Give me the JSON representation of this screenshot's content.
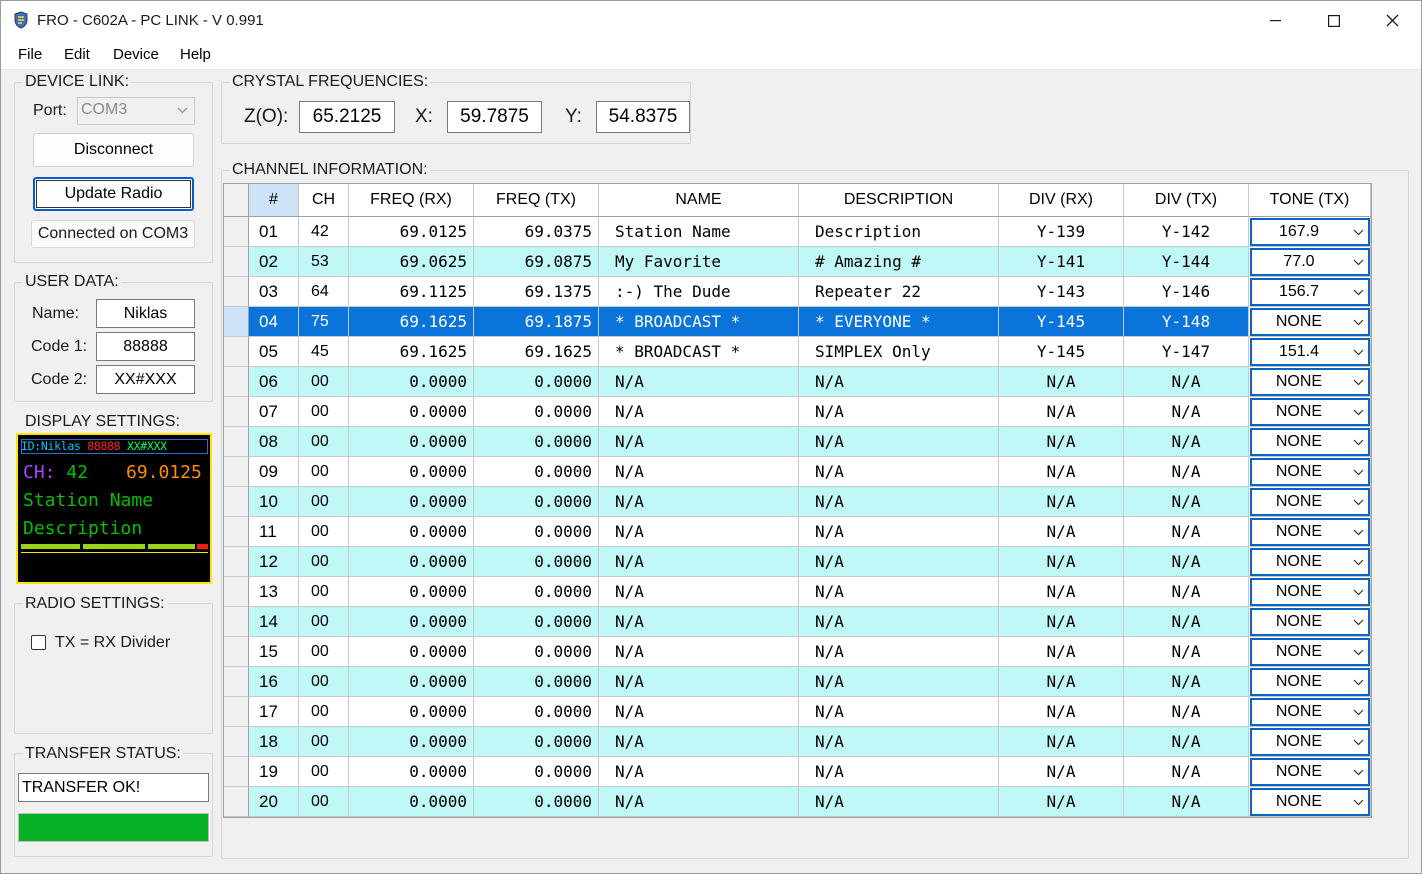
{
  "window": {
    "title": "FRO - C602A - PC LINK - V 0.991"
  },
  "menu": [
    "File",
    "Edit",
    "Device",
    "Help"
  ],
  "device_link": {
    "title": "DEVICE LINK:",
    "port_label": "Port:",
    "port_value": "COM3",
    "disconnect_label": "Disconnect",
    "update_label": "Update Radio",
    "status": "Connected on COM3"
  },
  "user_data": {
    "title": "USER DATA:",
    "name_label": "Name:",
    "name_value": "Niklas",
    "code1_label": "Code 1:",
    "code1_value": "88888",
    "code2_label": "Code 2:",
    "code2_value": "XX#XXX"
  },
  "display_settings": {
    "title": "DISPLAY SETTINGS:",
    "top_id": "ID:Niklas",
    "top_code1": "88888",
    "top_code2": "XX#XXX",
    "ch_label": "CH:",
    "ch_value": "42",
    "freq": "69.0125",
    "line2": "Station Name",
    "line3": "Description",
    "colors": {
      "id": "#00c8ff",
      "code1": "#ff2020",
      "code2": "#00ff66",
      "ch": "#b040ff",
      "freq": "#ff8c00",
      "text": "#00c000"
    }
  },
  "radio_settings": {
    "title": "RADIO SETTINGS:",
    "tx_rx_label": "TX = RX Divider",
    "tx_rx_checked": false
  },
  "transfer_status": {
    "title": "TRANSFER STATUS:",
    "text": "TRANSFER OK!",
    "progress": 1.0
  },
  "crystal": {
    "title": "CRYSTAL FREQUENCIES:",
    "z_label": "Z(O):",
    "z_value": "65.2125",
    "x_label": "X:",
    "x_value": "59.7875",
    "y_label": "Y:",
    "y_value": "54.8375"
  },
  "channels": {
    "title": "CHANNEL INFORMATION:",
    "headers": [
      "#",
      "CH",
      "FREQ (RX)",
      "FREQ (TX)",
      "NAME",
      "DESCRIPTION",
      "DIV (RX)",
      "DIV (TX)",
      "TONE (TX)"
    ],
    "selected_row": 3,
    "rows": [
      [
        "01",
        "42",
        "69.0125",
        "69.0375",
        "Station Name",
        "Description",
        "Y-139",
        "Y-142",
        "167.9"
      ],
      [
        "02",
        "53",
        "69.0625",
        "69.0875",
        "My Favorite",
        "# Amazing #",
        "Y-141",
        "Y-144",
        "77.0"
      ],
      [
        "03",
        "64",
        "69.1125",
        "69.1375",
        ":-) The Dude",
        "Repeater 22",
        "Y-143",
        "Y-146",
        "156.7"
      ],
      [
        "04",
        "75",
        "69.1625",
        "69.1875",
        "* BROADCAST *",
        "* EVERYONE *",
        "Y-145",
        "Y-148",
        "NONE"
      ],
      [
        "05",
        "45",
        "69.1625",
        "69.1625",
        "* BROADCAST *",
        "SIMPLEX Only",
        "Y-145",
        "Y-147",
        "151.4"
      ],
      [
        "06",
        "00",
        "0.0000",
        "0.0000",
        "N/A",
        "N/A",
        "N/A",
        "N/A",
        "NONE"
      ],
      [
        "07",
        "00",
        "0.0000",
        "0.0000",
        "N/A",
        "N/A",
        "N/A",
        "N/A",
        "NONE"
      ],
      [
        "08",
        "00",
        "0.0000",
        "0.0000",
        "N/A",
        "N/A",
        "N/A",
        "N/A",
        "NONE"
      ],
      [
        "09",
        "00",
        "0.0000",
        "0.0000",
        "N/A",
        "N/A",
        "N/A",
        "N/A",
        "NONE"
      ],
      [
        "10",
        "00",
        "0.0000",
        "0.0000",
        "N/A",
        "N/A",
        "N/A",
        "N/A",
        "NONE"
      ],
      [
        "11",
        "00",
        "0.0000",
        "0.0000",
        "N/A",
        "N/A",
        "N/A",
        "N/A",
        "NONE"
      ],
      [
        "12",
        "00",
        "0.0000",
        "0.0000",
        "N/A",
        "N/A",
        "N/A",
        "N/A",
        "NONE"
      ],
      [
        "13",
        "00",
        "0.0000",
        "0.0000",
        "N/A",
        "N/A",
        "N/A",
        "N/A",
        "NONE"
      ],
      [
        "14",
        "00",
        "0.0000",
        "0.0000",
        "N/A",
        "N/A",
        "N/A",
        "N/A",
        "NONE"
      ],
      [
        "15",
        "00",
        "0.0000",
        "0.0000",
        "N/A",
        "N/A",
        "N/A",
        "N/A",
        "NONE"
      ],
      [
        "16",
        "00",
        "0.0000",
        "0.0000",
        "N/A",
        "N/A",
        "N/A",
        "N/A",
        "NONE"
      ],
      [
        "17",
        "00",
        "0.0000",
        "0.0000",
        "N/A",
        "N/A",
        "N/A",
        "N/A",
        "NONE"
      ],
      [
        "18",
        "00",
        "0.0000",
        "0.0000",
        "N/A",
        "N/A",
        "N/A",
        "N/A",
        "NONE"
      ],
      [
        "19",
        "00",
        "0.0000",
        "0.0000",
        "N/A",
        "N/A",
        "N/A",
        "N/A",
        "NONE"
      ],
      [
        "20",
        "00",
        "0.0000",
        "0.0000",
        "N/A",
        "N/A",
        "N/A",
        "N/A",
        "NONE"
      ]
    ]
  },
  "colors": {
    "row_alt": "#c0f8f8",
    "row_selected": "#0a74da",
    "row_selected_text": "#ffffff",
    "header_selected": "#cce3f8",
    "progress": "#06b025"
  }
}
